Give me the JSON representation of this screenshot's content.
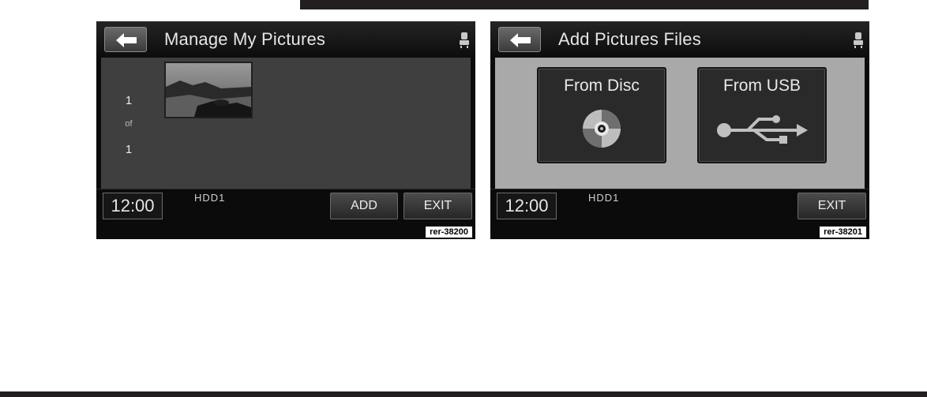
{
  "screens": [
    {
      "title": "Manage My Pictures",
      "page_indicator": {
        "current": "1",
        "separator": "of",
        "total": "1"
      },
      "footer": {
        "clock": "12:00",
        "source": "HDD1",
        "add_label": "ADD",
        "exit_label": "EXIT"
      },
      "figure_label": "rer-38200"
    },
    {
      "title": "Add Pictures Files",
      "options": [
        {
          "label": "From Disc",
          "icon": "disc-icon"
        },
        {
          "label": "From USB",
          "icon": "usb-icon"
        }
      ],
      "footer": {
        "clock": "12:00",
        "source": "HDD1",
        "exit_label": "EXIT"
      },
      "figure_label": "rer-38201"
    }
  ],
  "colors": {
    "screen_bg": "#0b0b0b",
    "content_dark": "#3f3f3f",
    "content_light": "#a9a9a9",
    "button_gray": "#2a2a2a",
    "text": "#e6e6e6"
  }
}
